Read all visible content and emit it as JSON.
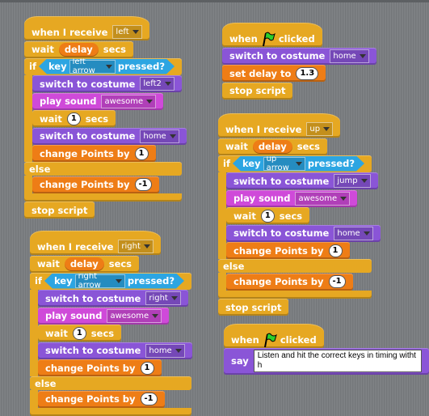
{
  "colors": {
    "control": "#e6a822",
    "looks": "#8a55d7",
    "sound": "#cf4ad9",
    "variables": "#ee7d16",
    "sensing": "#2ca5e2"
  },
  "scripts": [
    {
      "blocks": [
        {
          "cat": "control",
          "hat": true,
          "parts": [
            {
              "t": "when I receive"
            },
            {
              "dd": "left"
            }
          ]
        },
        {
          "cat": "control",
          "parts": [
            {
              "t": "wait"
            },
            {
              "rep": "delay"
            },
            {
              "t": "secs"
            }
          ]
        },
        {
          "cat": "control",
          "c": true,
          "parts": [
            {
              "t": "if"
            },
            {
              "bool": [
                {
                  "t": "key"
                },
                {
                  "dd": "left arrow"
                },
                {
                  "t": "pressed?"
                }
              ]
            }
          ],
          "children": [
            {
              "cat": "looks",
              "parts": [
                {
                  "t": "switch to costume"
                },
                {
                  "dd": "left2"
                }
              ]
            },
            {
              "cat": "sound",
              "parts": [
                {
                  "t": "play sound"
                },
                {
                  "dd": "awesome"
                }
              ]
            },
            {
              "cat": "control",
              "parts": [
                {
                  "t": "wait"
                },
                {
                  "num": "1"
                },
                {
                  "t": "secs"
                }
              ]
            },
            {
              "cat": "looks",
              "parts": [
                {
                  "t": "switch to costume"
                },
                {
                  "dd": "home"
                }
              ]
            },
            {
              "cat": "variables",
              "parts": [
                {
                  "t": "change Points by"
                },
                {
                  "num": "1"
                }
              ]
            }
          ],
          "else_label": "else",
          "else_children": [
            {
              "cat": "variables",
              "parts": [
                {
                  "t": "change Points by"
                },
                {
                  "num": "-1"
                }
              ]
            }
          ]
        },
        {
          "cat": "control",
          "parts": [
            {
              "t": "stop script"
            }
          ]
        }
      ]
    },
    {
      "blocks": [
        {
          "cat": "control",
          "hat": true,
          "parts": [
            {
              "t": "when"
            },
            {
              "icon": "green-flag"
            },
            {
              "t": "clicked"
            }
          ]
        },
        {
          "cat": "looks",
          "parts": [
            {
              "t": "switch to costume"
            },
            {
              "dd": "home"
            }
          ]
        },
        {
          "cat": "variables",
          "parts": [
            {
              "t": "set delay to"
            },
            {
              "num": "1.3"
            }
          ]
        },
        {
          "cat": "control",
          "parts": [
            {
              "t": "stop script"
            }
          ]
        }
      ]
    },
    {
      "blocks": [
        {
          "cat": "control",
          "hat": true,
          "parts": [
            {
              "t": "when I receive"
            },
            {
              "dd": "up"
            }
          ]
        },
        {
          "cat": "control",
          "parts": [
            {
              "t": "wait"
            },
            {
              "rep": "delay"
            },
            {
              "t": "secs"
            }
          ]
        },
        {
          "cat": "control",
          "c": true,
          "parts": [
            {
              "t": "if"
            },
            {
              "bool": [
                {
                  "t": "key"
                },
                {
                  "dd": "up arrow"
                },
                {
                  "t": "pressed?"
                }
              ]
            }
          ],
          "children": [
            {
              "cat": "looks",
              "parts": [
                {
                  "t": "switch to costume"
                },
                {
                  "dd": "jump"
                }
              ]
            },
            {
              "cat": "sound",
              "parts": [
                {
                  "t": "play sound"
                },
                {
                  "dd": "awesome"
                }
              ]
            },
            {
              "cat": "control",
              "parts": [
                {
                  "t": "wait"
                },
                {
                  "num": "1"
                },
                {
                  "t": "secs"
                }
              ]
            },
            {
              "cat": "looks",
              "parts": [
                {
                  "t": "switch to costume"
                },
                {
                  "dd": "home"
                }
              ]
            },
            {
              "cat": "variables",
              "parts": [
                {
                  "t": "change Points by"
                },
                {
                  "num": "1"
                }
              ]
            }
          ],
          "else_label": "else",
          "else_children": [
            {
              "cat": "variables",
              "parts": [
                {
                  "t": "change Points by"
                },
                {
                  "num": "-1"
                }
              ]
            }
          ]
        },
        {
          "cat": "control",
          "parts": [
            {
              "t": "stop script"
            }
          ]
        }
      ]
    },
    {
      "blocks": [
        {
          "cat": "control",
          "hat": true,
          "parts": [
            {
              "t": "when I receive"
            },
            {
              "dd": "right"
            }
          ]
        },
        {
          "cat": "control",
          "parts": [
            {
              "t": "wait"
            },
            {
              "rep": "delay"
            },
            {
              "t": "secs"
            }
          ]
        },
        {
          "cat": "control",
          "c": true,
          "parts": [
            {
              "t": "if"
            },
            {
              "bool": [
                {
                  "t": "key"
                },
                {
                  "dd": "right arrow"
                },
                {
                  "t": "pressed?"
                }
              ]
            }
          ],
          "children": [
            {
              "cat": "looks",
              "parts": [
                {
                  "t": "switch to costume"
                },
                {
                  "dd": "right"
                }
              ]
            },
            {
              "cat": "sound",
              "parts": [
                {
                  "t": "play sound"
                },
                {
                  "dd": "awesome"
                }
              ]
            },
            {
              "cat": "control",
              "parts": [
                {
                  "t": "wait"
                },
                {
                  "num": "1"
                },
                {
                  "t": "secs"
                }
              ]
            },
            {
              "cat": "looks",
              "parts": [
                {
                  "t": "switch to costume"
                },
                {
                  "dd": "home"
                }
              ]
            },
            {
              "cat": "variables",
              "parts": [
                {
                  "t": "change Points by"
                },
                {
                  "num": "1"
                }
              ]
            }
          ],
          "else_label": "else",
          "else_children": [
            {
              "cat": "variables",
              "parts": [
                {
                  "t": "change Points by"
                },
                {
                  "num": "-1"
                }
              ]
            }
          ]
        }
      ]
    },
    {
      "blocks": [
        {
          "cat": "control",
          "hat": true,
          "parts": [
            {
              "t": "when"
            },
            {
              "icon": "green-flag"
            },
            {
              "t": "clicked"
            }
          ]
        },
        {
          "cat": "looks",
          "parts": [
            {
              "t": "say"
            },
            {
              "str": "Listen and hit the correct keys in timing witht h"
            }
          ]
        }
      ]
    }
  ]
}
